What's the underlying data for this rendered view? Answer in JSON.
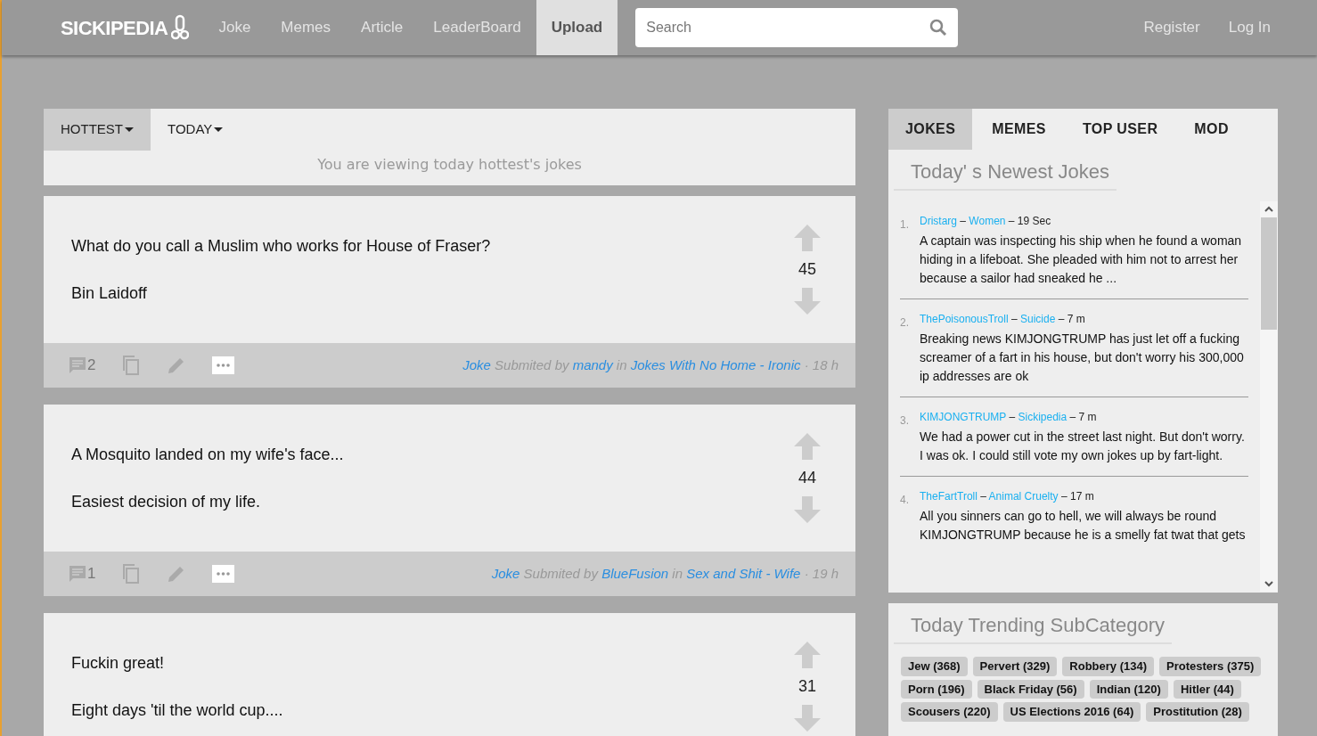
{
  "header": {
    "logo": "SICKIPEDIA",
    "nav": [
      {
        "label": "Joke",
        "selected": false
      },
      {
        "label": "Memes",
        "selected": false
      },
      {
        "label": "Article",
        "selected": false
      },
      {
        "label": "LeaderBoard",
        "selected": false
      },
      {
        "label": "Upload",
        "selected": true
      }
    ],
    "search": {
      "placeholder": "Search"
    },
    "auth": [
      "Register",
      "Log In"
    ]
  },
  "filter": {
    "tabs": [
      {
        "label": "HOTTEST",
        "selected": true
      },
      {
        "label": "TODAY",
        "selected": false
      }
    ],
    "message": "You are viewing today hottest's jokes"
  },
  "jokes": [
    {
      "setup": "What do you call a Muslim who works for House of Fraser?",
      "punchline": "Bin Laidoff",
      "score": "45",
      "footer": {
        "comments": "2",
        "type": "Joke",
        "submitted": "Submited by",
        "user": "mandy",
        "in": "in",
        "category": "Jokes With No Home",
        "dash": "-",
        "subcategory": "Ironic",
        "dot": "·",
        "age": "18 h"
      }
    },
    {
      "setup": "A Mosquito landed on my wife's face...",
      "punchline": "Easiest decision of my life.",
      "score": "44",
      "footer": {
        "comments": "1",
        "type": "Joke",
        "submitted": "Submited by",
        "user": "BlueFusion",
        "in": "in",
        "category": "Sex and Shit",
        "dash": "-",
        "subcategory": "Wife",
        "dot": "·",
        "age": "19 h"
      }
    },
    {
      "setup": "Fuckin great!",
      "punchline": "Eight days 'til the world cup....",
      "score": "31"
    }
  ],
  "sidebar": {
    "tabs": [
      {
        "label": "JOKES",
        "selected": true
      },
      {
        "label": "MEMES",
        "selected": false
      },
      {
        "label": "TOP USER",
        "selected": false
      },
      {
        "label": "MOD",
        "selected": false
      }
    ],
    "title": "Today' s Newest Jokes",
    "items": [
      {
        "number": "1.",
        "user": "Dristarg",
        "dash1": "–",
        "category": "Women",
        "dash2": "–",
        "time": "19 Sec",
        "text": "A captain was inspecting his ship when he found a woman hiding in a lifeboat. She pleaded with him not to arrest her because a sailor had sneaked he ..."
      },
      {
        "number": "2.",
        "user": "ThePoisonousTroll",
        "dash1": "–",
        "category": "Suicide",
        "dash2": "–",
        "time": "7 m",
        "text": "Breaking news KIMJONGTRUMP has just let off a fucking screamer of a fart in his house, but don't worry his 300,000 ip addresses are ok"
      },
      {
        "number": "3.",
        "user": "KIMJONGTRUMP",
        "dash1": "–",
        "category": "Sickipedia",
        "dash2": "–",
        "time": "7 m",
        "text": "We had a power cut in the street last night. But don't worry. I was ok. I could still vote my own jokes up by fart-light."
      },
      {
        "number": "4.",
        "user": "TheFartTroll",
        "dash1": "–",
        "category": "Animal Cruelty",
        "dash2": "–",
        "time": "17 m",
        "text": "All you sinners can go to hell, we will always be round KIMJONGTRUMP because he is a smelly fat twat that gets"
      }
    ],
    "trending": {
      "title": "Today Trending SubCategory",
      "tags": [
        "Jew (368)",
        "Pervert (329)",
        "Robbery (134)",
        "Protesters (375)",
        "Porn (196)",
        "Black Friday (56)",
        "Indian (120)",
        "Hitler (44)",
        "Scousers (220)",
        "US Elections 2016 (64)",
        "Prostitution (28)"
      ]
    }
  }
}
